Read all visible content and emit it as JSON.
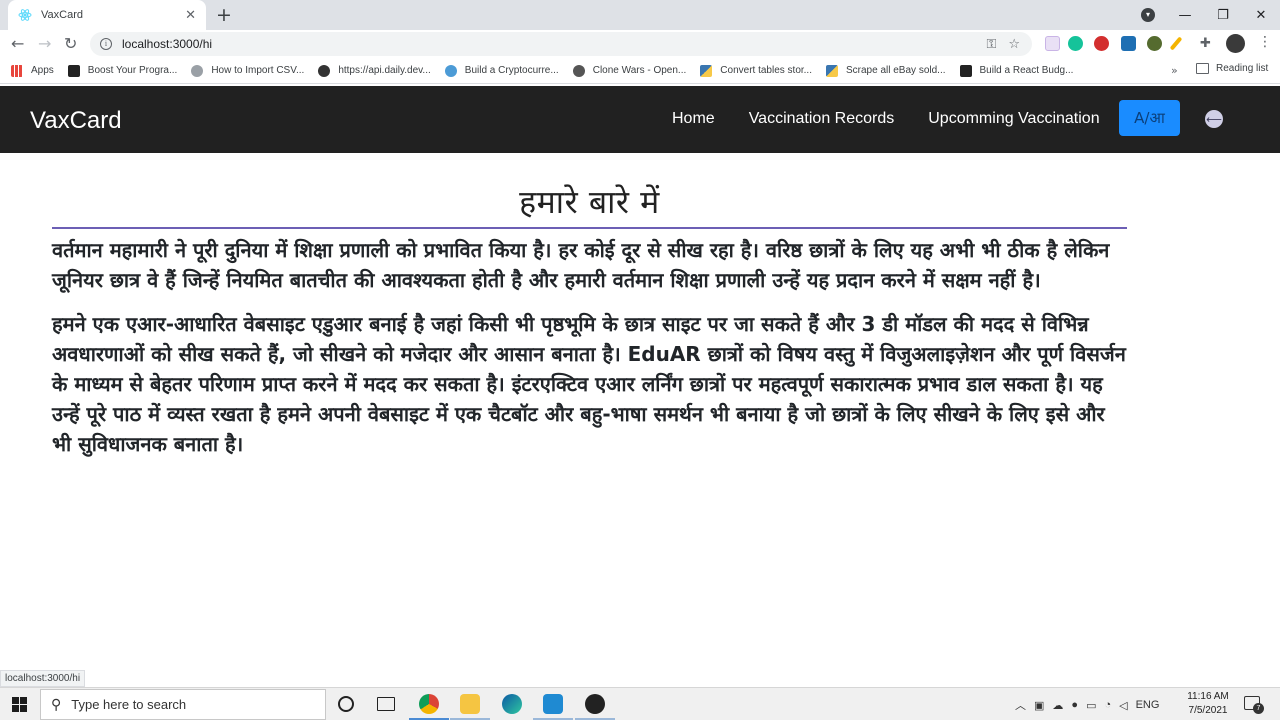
{
  "browser": {
    "tab_title": "VaxCard",
    "new_tab": "+",
    "tab_close": "✕",
    "url": "localhost:3000/hi",
    "status_url": "localhost:3000/hi",
    "window_controls": [
      "—",
      "❐",
      "✕"
    ],
    "bookmarks": [
      {
        "label": "Apps",
        "color": "#e8453c"
      },
      {
        "label": "Boost Your Progra...",
        "color": "#222222"
      },
      {
        "label": "How to Import CSV...",
        "color": "#9aa0a6"
      },
      {
        "label": "https://api.daily.dev...",
        "color": "#333333"
      },
      {
        "label": "Build a Cryptocurre...",
        "color": "#4c9bd6"
      },
      {
        "label": "Clone Wars - Open...",
        "color": "#555555"
      },
      {
        "label": "Convert tables stor...",
        "color": "#3a76b0"
      },
      {
        "label": "Scrape all eBay sold...",
        "color": "#3a76b0"
      },
      {
        "label": "Build a React Budg...",
        "color": "#222222"
      }
    ],
    "bookmarks_more": "»",
    "reading_list": "Reading list"
  },
  "app": {
    "brand": "VaxCard",
    "nav": [
      "Home",
      "Vaccination Records",
      "Upcomming Vaccination"
    ],
    "lang_button": "A/आ",
    "accent": "#1a8cff"
  },
  "content": {
    "heading": "हमारे बारे में",
    "paragraphs": [
      "वर्तमान महामारी ने पूरी दुनिया में शिक्षा प्रणाली को प्रभावित किया है। हर कोई दूर से सीख रहा है। वरिष्ठ छात्रों के लिए यह अभी भी ठीक है लेकिन जूनियर छात्र वे हैं जिन्हें नियमित बातचीत की आवश्यकता होती है और हमारी वर्तमान शिक्षा प्रणाली उन्हें यह प्रदान करने में सक्षम नहीं है।",
      "हमने एक एआर-आधारित वेबसाइट एडुआर बनाई है जहां किसी भी पृष्ठभूमि के छात्र साइट पर जा सकते हैं और 3 डी मॉडल की मदद से विभिन्न अवधारणाओं को सीख सकते हैं, जो सीखने को मजेदार और आसान बनाता है। EduAR छात्रों को विषय वस्तु में विजुअलाइज़ेशन और पूर्ण विसर्जन के माध्यम से बेहतर परिणाम प्राप्त करने में मदद कर सकता है। इंटरएक्टिव एआर लर्निंग छात्रों पर महत्वपूर्ण सकारात्मक प्रभाव डाल सकता है। यह उन्हें पूरे पाठ में व्यस्त रखता है हमने अपनी वेबसाइट में एक चैटबॉट और बहु-भाषा समर्थन भी बनाया है जो छात्रों के लिए सीखने के लिए इसे और भी सुविधाजनक बनाता है।"
    ]
  },
  "taskbar": {
    "search_placeholder": "Type here to search",
    "lang": "ENG",
    "time": "11:16 AM",
    "date": "7/5/2021",
    "notifications": "7"
  }
}
